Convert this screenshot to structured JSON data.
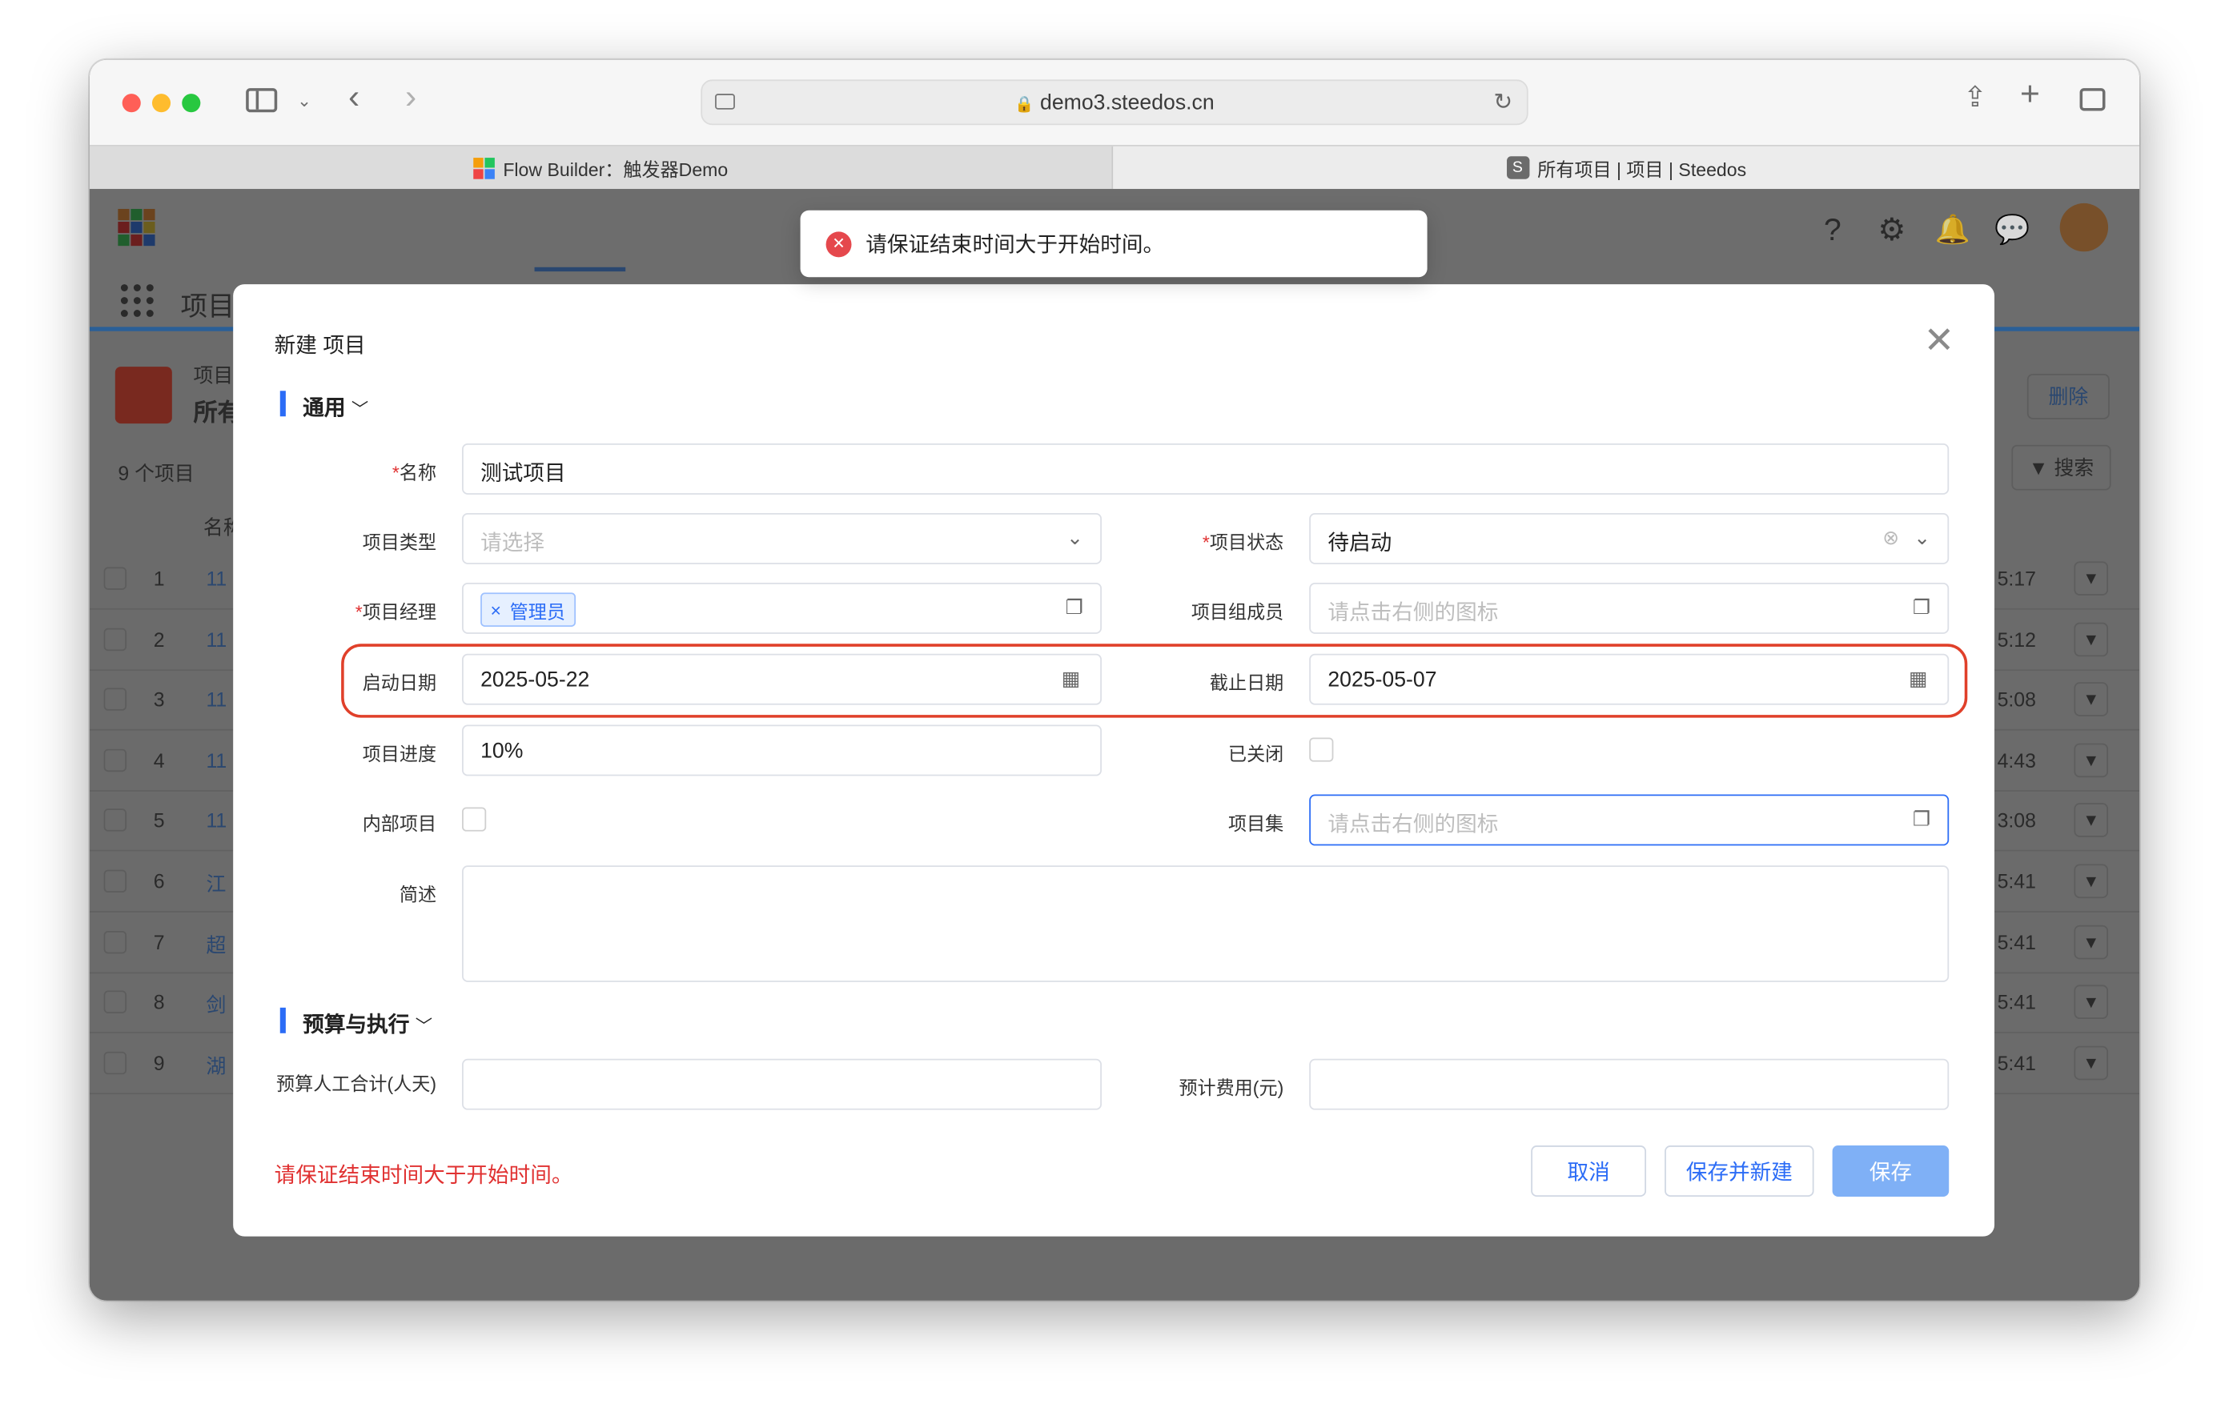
{
  "browser": {
    "url": "demo3.steedos.cn",
    "tabs": [
      {
        "title": "Flow Builder：触发器Demo"
      },
      {
        "title": "所有项目 | 项目 | Steedos"
      }
    ],
    "colors": {
      "close": "#ff5f57",
      "minimize": "#febc2e",
      "zoom": "#28c840"
    }
  },
  "background": {
    "app_title": "项目",
    "object_label": "项目",
    "view_label": "所有",
    "record_count": "9 个项目",
    "column_name": "名称",
    "delete_button": "删除",
    "search_button": "搜索",
    "rows": [
      {
        "num": "1",
        "name": "11",
        "time": "5:17"
      },
      {
        "num": "2",
        "name": "11",
        "time": "5:12"
      },
      {
        "num": "3",
        "name": "11",
        "time": "5:08"
      },
      {
        "num": "4",
        "name": "11",
        "time": "4:43"
      },
      {
        "num": "5",
        "name": "11",
        "time": "3:08"
      },
      {
        "num": "6",
        "name": "江",
        "time": "5:41"
      },
      {
        "num": "7",
        "name": "超",
        "time": "5:41"
      },
      {
        "num": "8",
        "name": "剑",
        "time": "5:41"
      },
      {
        "num": "9",
        "name": "湖",
        "time": "5:41"
      }
    ]
  },
  "toast": {
    "message": "请保证结束时间大于开始时间。"
  },
  "modal": {
    "title": "新建 项目",
    "section_general": "通用",
    "section_budget": "预算与执行",
    "fields": {
      "name": {
        "label": "名称",
        "value": "测试项目"
      },
      "type": {
        "label": "项目类型",
        "placeholder": "请选择"
      },
      "status": {
        "label": "项目状态",
        "value": "待启动"
      },
      "manager": {
        "label": "项目经理",
        "tag": "管理员"
      },
      "members": {
        "label": "项目组成员",
        "placeholder": "请点击右侧的图标"
      },
      "start_date": {
        "label": "启动日期",
        "value": "2025-05-22"
      },
      "end_date": {
        "label": "截止日期",
        "value": "2025-05-07"
      },
      "progress": {
        "label": "项目进度",
        "value": "10%"
      },
      "closed": {
        "label": "已关闭"
      },
      "internal": {
        "label": "内部项目"
      },
      "program": {
        "label": "项目集",
        "placeholder": "请点击右侧的图标"
      },
      "description": {
        "label": "简述"
      },
      "budget_hours": {
        "label": "预算人工合计(人天)"
      },
      "budget_cost": {
        "label": "预计费用(元)"
      }
    },
    "error_text": "请保证结束时间大于开始时间。",
    "buttons": {
      "cancel": "取消",
      "save_new": "保存并新建",
      "save": "保存"
    }
  }
}
